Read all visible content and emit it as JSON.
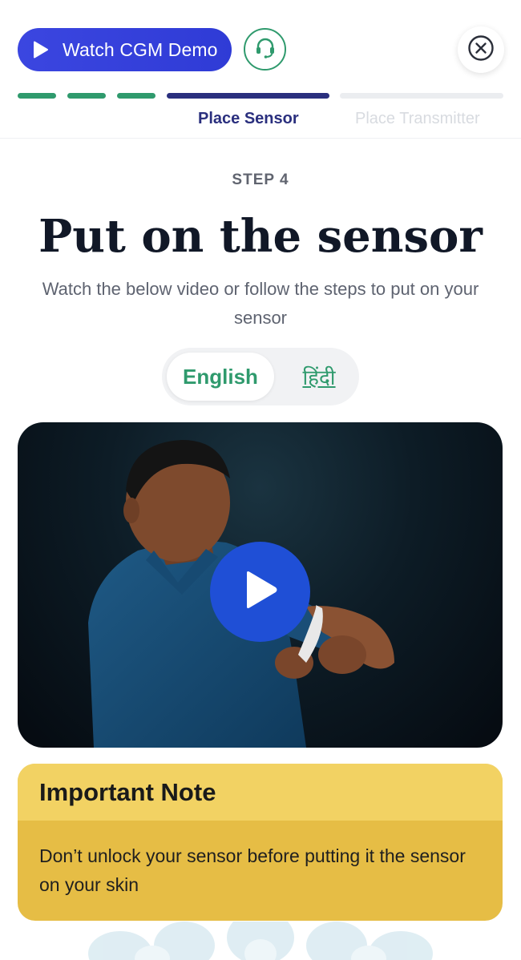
{
  "header": {
    "demo_button_label": "Watch CGM Demo",
    "colors": {
      "demo_button": "#3b46e0",
      "support_green": "#2f9a6d",
      "active_step": "#2a2f7e"
    },
    "icons": {
      "demo": "play-icon",
      "support": "headset-icon",
      "close": "close-icon"
    }
  },
  "progress": {
    "completed_segments": 3,
    "active_label": "Place Sensor",
    "upcoming_label": "Place Transmitter"
  },
  "step": {
    "number_label": "STEP 4",
    "title": "Put on the sensor",
    "subtitle": "Watch the below video or follow the steps to put on your sensor"
  },
  "language": {
    "options": [
      "English",
      "हिंदी"
    ],
    "selected": "English"
  },
  "video": {
    "play_icon": "play-icon"
  },
  "note": {
    "heading": "Important Note",
    "body": "Don’t unlock your sensor before putting it the sensor on your skin",
    "colors": {
      "header": "#f2d263",
      "body": "#e6bd45"
    }
  }
}
